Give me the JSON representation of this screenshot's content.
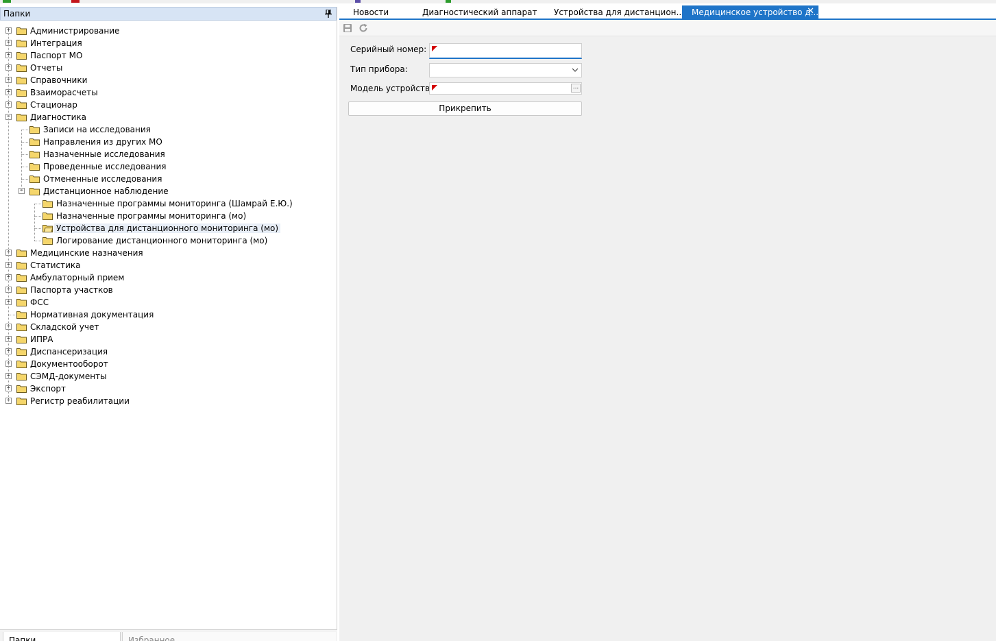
{
  "left_panel": {
    "title": "Папки",
    "tree": [
      {
        "label": "Администрирование",
        "level": 0,
        "expander": "+"
      },
      {
        "label": "Интеграция",
        "level": 0,
        "expander": "+"
      },
      {
        "label": "Паспорт МО",
        "level": 0,
        "expander": "+"
      },
      {
        "label": "Отчеты",
        "level": 0,
        "expander": "+"
      },
      {
        "label": "Справочники",
        "level": 0,
        "expander": "+"
      },
      {
        "label": "Взаиморасчеты",
        "level": 0,
        "expander": "+"
      },
      {
        "label": "Стационар",
        "level": 0,
        "expander": "+"
      },
      {
        "label": "Диагностика",
        "level": 0,
        "expander": "-"
      },
      {
        "label": "Записи на исследования",
        "level": 1,
        "expander": ""
      },
      {
        "label": "Направления из других МО",
        "level": 1,
        "expander": ""
      },
      {
        "label": "Назначенные исследования",
        "level": 1,
        "expander": ""
      },
      {
        "label": "Проведенные исследования",
        "level": 1,
        "expander": ""
      },
      {
        "label": "Отмененные исследования",
        "level": 1,
        "expander": ""
      },
      {
        "label": "Дистанционное наблюдение",
        "level": 1,
        "expander": "-"
      },
      {
        "label": "Назначенные программы мониторинга (Шамрай Е.Ю.)",
        "level": 2,
        "expander": ""
      },
      {
        "label": "Назначенные программы мониторинга (мо)",
        "level": 2,
        "expander": ""
      },
      {
        "label": "Устройства для дистанционного мониторинга (мо)",
        "level": 2,
        "expander": "",
        "selected": true
      },
      {
        "label": "Логирование дистанционного мониторинга (мо)",
        "level": 2,
        "expander": ""
      },
      {
        "label": "Медицинские назначения",
        "level": 0,
        "expander": "+"
      },
      {
        "label": "Статистика",
        "level": 0,
        "expander": "+"
      },
      {
        "label": "Амбулаторный прием",
        "level": 0,
        "expander": "+"
      },
      {
        "label": "Паспорта участков",
        "level": 0,
        "expander": "+"
      },
      {
        "label": "ФСС",
        "level": 0,
        "expander": "+"
      },
      {
        "label": "Нормативная документация",
        "level": 0,
        "expander": ""
      },
      {
        "label": "Складской учет",
        "level": 0,
        "expander": "+"
      },
      {
        "label": "ИПРА",
        "level": 0,
        "expander": "+"
      },
      {
        "label": "Диспансеризация",
        "level": 0,
        "expander": "+"
      },
      {
        "label": "Документооборот",
        "level": 0,
        "expander": "+"
      },
      {
        "label": "СЭМД-документы",
        "level": 0,
        "expander": "+"
      },
      {
        "label": "Экспорт",
        "level": 0,
        "expander": "+"
      },
      {
        "label": "Регистр реабилитации",
        "level": 0,
        "expander": "+"
      }
    ],
    "bottom_tabs": {
      "folders": "Папки",
      "favorites": "Избранное"
    }
  },
  "tabs": [
    {
      "label": "Новости",
      "active": false
    },
    {
      "label": "Диагностический аппарат",
      "active": false
    },
    {
      "label": "Устройства для дистанцион...",
      "active": false
    },
    {
      "label": "Медицинское устройство д...",
      "active": true
    }
  ],
  "toolbar": {
    "icons": [
      "save-icon",
      "refresh-icon"
    ]
  },
  "form": {
    "serial_label": "Серийный номер:",
    "serial_value": "",
    "type_label": "Тип прибора:",
    "type_value": "",
    "model_label": "Модель устройства:",
    "model_value": "",
    "model_button": "...",
    "attach_button": "Прикрепить"
  },
  "colors": {
    "accent": "#1e74c8",
    "header": "#d7e4f5",
    "folder": "#f5d66b",
    "required_flag": "#d40000"
  }
}
